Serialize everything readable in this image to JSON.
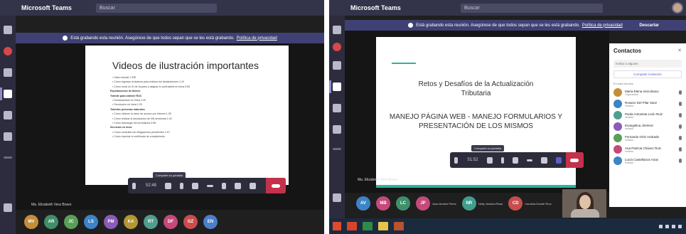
{
  "app": {
    "name": "Microsoft Teams",
    "search_placeholder": "Buscar"
  },
  "colors": {
    "titlebar": "#33344a",
    "rail": "#2d2c3e",
    "banner": "#3f4174",
    "hangup": "#c4314b",
    "accent": "#5b5fc7",
    "slide_teal": "#2db3a0"
  },
  "left": {
    "banner": {
      "bold": "Está grabando",
      "text": "Está grabando esta reunión. Asegúrese de que todos sepan que se les está grabando.",
      "link": "Política de privacidad"
    },
    "slide": {
      "title": "Videos de ilustración importantes",
      "lines": [
        {
          "text": "Video tutorial 1 SRI",
          "type": "bullet"
        },
        {
          "text": "Cómo ingresar al sistema para realizar tus declaraciones 1:10",
          "type": "bullet"
        },
        {
          "text": "Cómo crear un ID de Usuario y asignar tu contraseña en línea 0:50",
          "type": "bullet"
        },
        {
          "text": "Exportaciones de bienes",
          "type": "head"
        },
        {
          "text": "Trámite para obtener RUC",
          "type": "head"
        },
        {
          "text": "Declaraciones en línea 2:40",
          "type": "bullet"
        },
        {
          "text": "Devolución en línea 1:20",
          "type": "bullet"
        },
        {
          "text": "Trámites personas naturales",
          "type": "head"
        },
        {
          "text": "Cómo obtener la clave de acceso por internet 1:35",
          "type": "bullet"
        },
        {
          "text": "Cómo realizar la declaración de IVA semestral 1:42",
          "type": "bullet"
        },
        {
          "text": "Cómo descargar los formularios 0:58",
          "type": "bullet"
        },
        {
          "text": "Servicios en línea",
          "type": "head"
        },
        {
          "text": "Cómo consultar las obligaciones pendientes 1:10",
          "type": "bullet"
        },
        {
          "text": "Cómo imprimir el certificado de cumplimiento",
          "type": "bullet"
        }
      ]
    },
    "controls": {
      "time": "52:48",
      "tooltip": "Comparte su pantalla"
    },
    "presenter_name": "Ma. Elizabeth Vera Bravo",
    "participants": [
      {
        "initials": "MV",
        "color": "#c58d3a"
      },
      {
        "initials": "AR",
        "color": "#3f8f6b"
      },
      {
        "initials": "JC",
        "color": "#5a9f57"
      },
      {
        "initials": "LS",
        "color": "#3c84c7"
      },
      {
        "initials": "PM",
        "color": "#8a5cb8"
      },
      {
        "initials": "KA",
        "color": "#b49735"
      },
      {
        "initials": "RT",
        "color": "#4f9e8e"
      },
      {
        "initials": "DF",
        "color": "#c5497a"
      },
      {
        "initials": "GZ",
        "color": "#c94d4d"
      },
      {
        "initials": "EN",
        "color": "#4d7ec9"
      }
    ]
  },
  "right": {
    "banner": {
      "bold": "Está grabando",
      "text": "Está grabando esta reunión. Asegúrese de que todos sepan que se les está grabando.",
      "link": "Política de privacidad",
      "action": "Descartar"
    },
    "slide": {
      "title_line1": "Retos y Desafíos de la Actualización",
      "title_line2": "Tributaria",
      "subtitle_line1": "MANEJO PÁGINA WEB - MANEJO FORMULARIOS Y",
      "subtitle_line2": "PRESENTACIÓN DE LOS MISMOS"
    },
    "controls": {
      "time": "51:52",
      "tooltip": "Comparte su pantalla"
    },
    "presenter_name": "Ma. Elizabeth Vera Bravo",
    "participants": [
      {
        "initials": "AV",
        "color": "#3c84c7",
        "name": ""
      },
      {
        "initials": "MB",
        "color": "#c5497a",
        "name": ""
      },
      {
        "initials": "LC",
        "color": "#3f8f6b",
        "name": ""
      },
      {
        "initials": "JP",
        "color": "#c5497a",
        "name": "Juan Andrés Pérez"
      },
      {
        "initials": "NR",
        "color": "#3f9e8e",
        "name": "Nelly Jessica Rivas"
      },
      {
        "initials": "CD",
        "color": "#c94d4d",
        "name": "Carolina Duarte Ríos"
      }
    ],
    "contacts": {
      "title": "Contactos",
      "input_placeholder": "Invitar a alguien",
      "share_label": "Compartir invitación",
      "section": "En esta reunión",
      "people": [
        {
          "name": "María Elena Vera Bravo",
          "role": "Organizador",
          "color": "#c58d3a"
        },
        {
          "name": "Rosario Del Pilar Sanz",
          "role": "Invitado",
          "color": "#3c84c7"
        },
        {
          "name": "Paola Antonieta León Ruiz",
          "role": "Invitado",
          "color": "#4f9e8e"
        },
        {
          "name": "Evangelina Jiménez",
          "role": "Invitado",
          "color": "#8a5cb8"
        },
        {
          "name": "Fernando Ortiz Andrade",
          "role": "Invitado",
          "color": "#5a9f57"
        },
        {
          "name": "Ana Patricia Chávez Ruiz",
          "role": "Invitado",
          "color": "#c5497a"
        },
        {
          "name": "Lucía Castellanos Arias",
          "role": "Invitado",
          "color": "#3c84c7"
        }
      ]
    }
  }
}
